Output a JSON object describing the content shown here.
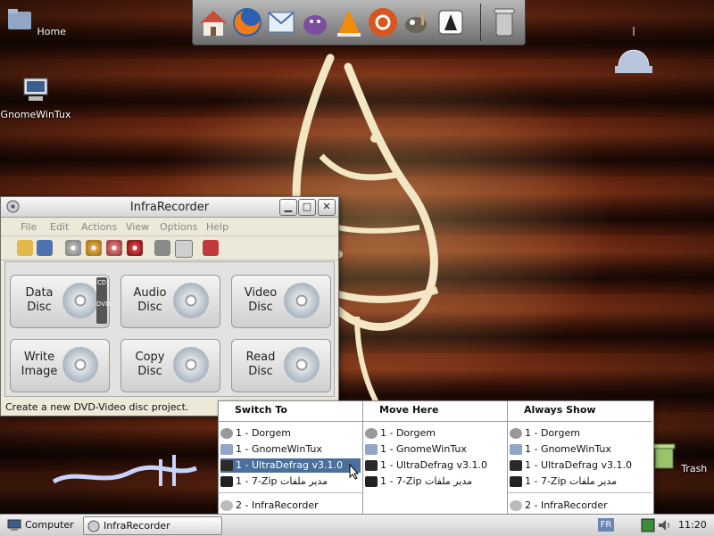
{
  "desktop": {
    "icons": [
      {
        "label": "Home",
        "icon": "home-folder-icon"
      },
      {
        "label": "GnomeWinTux",
        "icon": "computer-icon"
      },
      {
        "label": "Trash",
        "icon": "trash-icon"
      }
    ]
  },
  "dock": {
    "items": [
      "home-icon",
      "firefox-icon",
      "mail-icon",
      "pidgin-icon",
      "vlc-icon",
      "ubuntu-icon",
      "gimp-icon",
      "inkscape-icon",
      "trash-can-icon"
    ]
  },
  "window": {
    "title": "InfraRecorder",
    "controls": {
      "minimize": "▁",
      "maximize": "□",
      "close": "✕"
    },
    "menu": [
      "File",
      "Edit",
      "Actions",
      "View",
      "Options",
      "Help"
    ],
    "toolbar": [
      "open-icon",
      "save-icon",
      "burn-image-icon",
      "copy-disc-icon",
      "tracks-icon",
      "erase-icon",
      "tools-icon",
      "drive-icon",
      "exit-icon"
    ],
    "buttons": [
      {
        "label": "Data Disc",
        "icon": "data-disc-icon"
      },
      {
        "label": "Audio Disc",
        "icon": "audio-disc-icon"
      },
      {
        "label": "Video Disc",
        "icon": "video-disc-icon"
      },
      {
        "label": "Write Image",
        "icon": "write-image-icon"
      },
      {
        "label": "Copy Disc",
        "icon": "copy-disc-icon"
      },
      {
        "label": "Read Disc",
        "icon": "read-disc-icon"
      }
    ],
    "disc_tags": [
      "CD",
      "DVD"
    ],
    "status": "Create a new DVD-Video disc project."
  },
  "popup": {
    "columns": [
      {
        "header": "Switch To",
        "items": [
          "1 - Dorgem",
          "1 - GnomeWinTux",
          "1 - UltraDefrag v3.1.0",
          "1 - 7-Zip مدير ملفات",
          "2 - InfraRecorder"
        ]
      },
      {
        "header": "Move Here",
        "items": [
          "1 - Dorgem",
          "1 - GnomeWinTux",
          "1 - UltraDefrag v3.1.0",
          "1 - 7-Zip مدير ملفات"
        ]
      },
      {
        "header": "Always Show",
        "items": [
          "1 - Dorgem",
          "1 - GnomeWinTux",
          "1 - UltraDefrag v3.1.0",
          "1 - 7-Zip مدير ملفات",
          "2 - InfraRecorder"
        ]
      }
    ],
    "selected": "1 - UltraDefrag v3.1.0"
  },
  "taskbar": {
    "start_label": "Computer",
    "tasks": [
      "InfraRecorder"
    ],
    "lang": "FR",
    "clock": "11:20"
  },
  "colors": {
    "selection": "#4a6f9c",
    "accent": "#c9a35c"
  }
}
